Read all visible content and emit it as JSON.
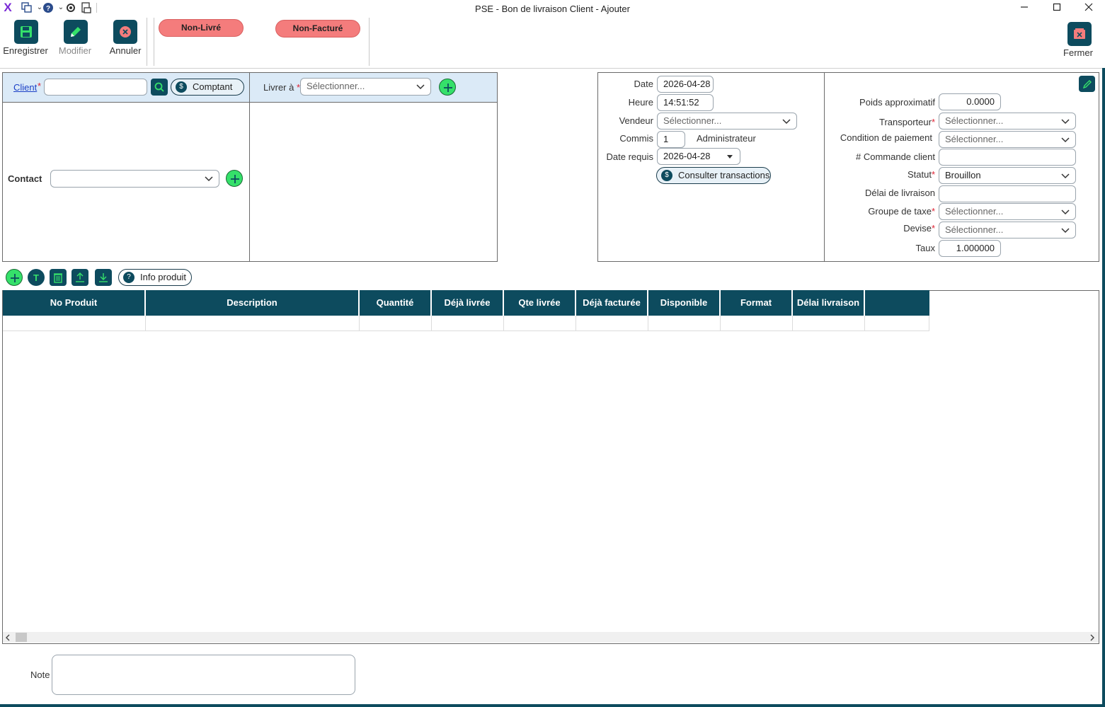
{
  "window": {
    "title": "PSE - Bon de livraison Client - Ajouter",
    "controls": [
      "minimize-icon",
      "maximize-icon",
      "close-icon"
    ]
  },
  "quick_access": [
    "app-logo-icon",
    "copy-icon",
    "help-icon",
    "settings-icon",
    "print-icon"
  ],
  "toolbar": {
    "save_label": "Enregistrer",
    "modify_label": "Modifier",
    "cancel_label": "Annuler",
    "close_label": "Fermer",
    "status_delivery": "Non-Livré",
    "status_invoice": "Non-Facturé"
  },
  "client_panel": {
    "client_label": "Client",
    "client_value": "",
    "cash_label": "Comptant",
    "contact_label": "Contact",
    "contact_value": ""
  },
  "delivery_panel": {
    "deliver_to_label": "Livrer à",
    "deliver_to_placeholder": "Sélectionner..."
  },
  "info_panel": {
    "date_label": "Date",
    "date_value": "2026-04-28",
    "time_label": "Heure",
    "time_value": "14:51:52",
    "seller_label": "Vendeur",
    "seller_placeholder": "Sélectionner...",
    "clerk_label": "Commis",
    "clerk_value": "1",
    "clerk_name": "Administrateur",
    "required_date_label": "Date requis",
    "required_date_value": "2026-04-28",
    "transactions_label": "Consulter transactions"
  },
  "details_panel": {
    "weight_label": "Poids approximatif",
    "weight_value": "0.0000",
    "carrier_label": "Transporteur",
    "carrier_placeholder": "Sélectionner...",
    "payment_label": "Condition de paiement",
    "payment_placeholder": "Sélectionner...",
    "order_label": "# Commande client",
    "order_value": "",
    "status_label": "Statut",
    "status_value": "Brouillon",
    "delay_label": "Délai de livraison",
    "delay_value": "",
    "tax_label": "Groupe de taxe",
    "tax_placeholder": "Sélectionner...",
    "currency_label": "Devise",
    "currency_placeholder": "Sélectionner...",
    "rate_label": "Taux",
    "rate_value": "1.000000"
  },
  "grid_toolbar": {
    "product_info_label": "Info produit"
  },
  "grid": {
    "columns": [
      "No Produit",
      "Description",
      "Quantité",
      "Déjà livrée",
      "Qte livrée",
      "Déjà facturée",
      "Disponible",
      "Format",
      "Délai livraison",
      ""
    ]
  },
  "note": {
    "label": "Note",
    "value": ""
  },
  "colors": {
    "primary": "#0d4b5e",
    "status_pill": "#f47c7c",
    "add_green": "#35e06a",
    "header_strip": "#dbeaf7"
  }
}
